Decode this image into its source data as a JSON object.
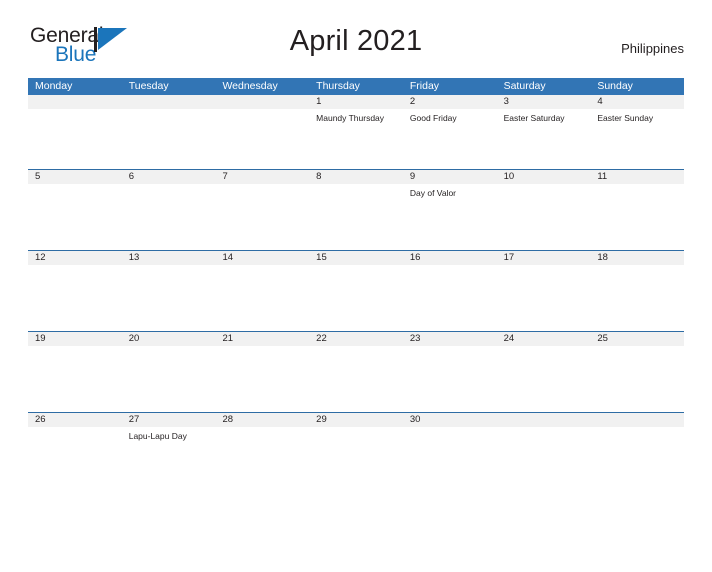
{
  "logo": {
    "word_one": "General",
    "word_two": "Blue",
    "accent_color": "#1b75bb",
    "flag_icon": "flag-triangle-icon"
  },
  "header": {
    "title": "April 2021",
    "country": "Philippines"
  },
  "calendar": {
    "header_color": "#3275b5",
    "date_band_color": "#f1f1f1",
    "row_divider_color": "#2e6ca4",
    "weekdays": [
      "Monday",
      "Tuesday",
      "Wednesday",
      "Thursday",
      "Friday",
      "Saturday",
      "Sunday"
    ],
    "weeks": [
      {
        "days": [
          {
            "date": "",
            "event": ""
          },
          {
            "date": "",
            "event": ""
          },
          {
            "date": "",
            "event": ""
          },
          {
            "date": "1",
            "event": "Maundy Thursday"
          },
          {
            "date": "2",
            "event": "Good Friday"
          },
          {
            "date": "3",
            "event": "Easter Saturday"
          },
          {
            "date": "4",
            "event": "Easter Sunday"
          }
        ]
      },
      {
        "days": [
          {
            "date": "5",
            "event": ""
          },
          {
            "date": "6",
            "event": ""
          },
          {
            "date": "7",
            "event": ""
          },
          {
            "date": "8",
            "event": ""
          },
          {
            "date": "9",
            "event": "Day of Valor"
          },
          {
            "date": "10",
            "event": ""
          },
          {
            "date": "11",
            "event": ""
          }
        ]
      },
      {
        "days": [
          {
            "date": "12",
            "event": ""
          },
          {
            "date": "13",
            "event": ""
          },
          {
            "date": "14",
            "event": ""
          },
          {
            "date": "15",
            "event": ""
          },
          {
            "date": "16",
            "event": ""
          },
          {
            "date": "17",
            "event": ""
          },
          {
            "date": "18",
            "event": ""
          }
        ]
      },
      {
        "days": [
          {
            "date": "19",
            "event": ""
          },
          {
            "date": "20",
            "event": ""
          },
          {
            "date": "21",
            "event": ""
          },
          {
            "date": "22",
            "event": ""
          },
          {
            "date": "23",
            "event": ""
          },
          {
            "date": "24",
            "event": ""
          },
          {
            "date": "25",
            "event": ""
          }
        ]
      },
      {
        "days": [
          {
            "date": "26",
            "event": ""
          },
          {
            "date": "27",
            "event": "Lapu-Lapu Day"
          },
          {
            "date": "28",
            "event": ""
          },
          {
            "date": "29",
            "event": ""
          },
          {
            "date": "30",
            "event": ""
          },
          {
            "date": "",
            "event": ""
          },
          {
            "date": "",
            "event": ""
          }
        ]
      }
    ]
  }
}
